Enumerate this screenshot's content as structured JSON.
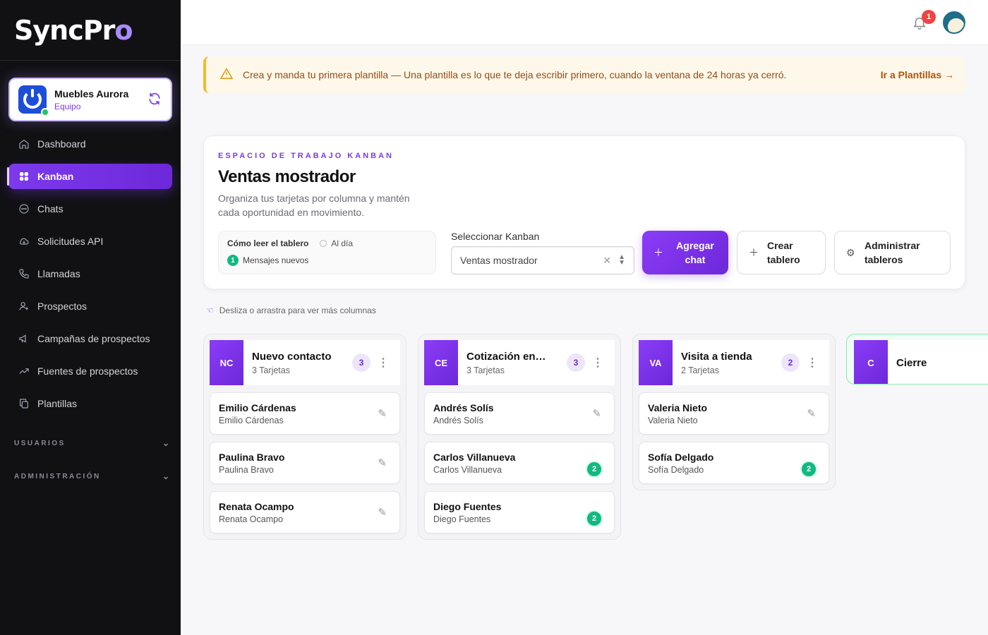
{
  "brand": {
    "name_main": "SyncPr",
    "name_accent": "o"
  },
  "account": {
    "name": "Muebles Aurora",
    "role": "Equipo"
  },
  "nav": [
    {
      "label": "Dashboard",
      "icon": "home-icon"
    },
    {
      "label": "Kanban",
      "icon": "grid-icon",
      "active": true
    },
    {
      "label": "Chats",
      "icon": "chat-icon"
    },
    {
      "label": "Solicitudes API",
      "icon": "cloud-icon"
    },
    {
      "label": "Llamadas",
      "icon": "phone-icon"
    },
    {
      "label": "Prospectos",
      "icon": "user-plus-icon"
    },
    {
      "label": "Campañas de prospectos",
      "icon": "megaphone-icon"
    },
    {
      "label": "Fuentes de prospectos",
      "icon": "trend-icon"
    },
    {
      "label": "Plantillas",
      "icon": "copy-icon"
    }
  ],
  "sections": {
    "users": "USUARIOS",
    "admin": "ADMINISTRACIÓN"
  },
  "topbar": {
    "notifications": "1"
  },
  "banner": {
    "message": "Crea y manda tu primera plantilla — Una plantilla es lo que te deja escribir primero, cuando la ventana de 24 horas ya cerró.",
    "link": "Ir a Plantillas →"
  },
  "workspace": {
    "eyebrow": "ESPACIO DE TRABAJO KANBAN",
    "title": "Ventas mostrador",
    "description": "Organiza tus tarjetas por columna y mantén cada oportunidad en movimiento.",
    "legend": {
      "title": "Cómo leer el tablero",
      "up_to_date": "Al día",
      "new_badge": "1",
      "new_messages": "Mensajes nuevos"
    },
    "select": {
      "label": "Seleccionar Kanban",
      "value": "Ventas mostrador"
    },
    "buttons": {
      "add_chat": "Agregar chat",
      "create_board": "Crear tablero",
      "manage_boards": "Administrar tableros"
    }
  },
  "hint": "Desliza o arrastra para ver más columnas",
  "columns": [
    {
      "abbr": "NC",
      "title": "Nuevo contacto",
      "subtitle": "3 Tarjetas",
      "count": "3",
      "cards": [
        {
          "name": "Emilio Cárdenas",
          "sub": "Emilio Cárdenas",
          "badge": null
        },
        {
          "name": "Paulina Bravo",
          "sub": "Paulina Bravo",
          "badge": null
        },
        {
          "name": "Renata Ocampo",
          "sub": "Renata Ocampo",
          "badge": null
        }
      ]
    },
    {
      "abbr": "CE",
      "title": "Cotización envi...",
      "subtitle": "3 Tarjetas",
      "count": "3",
      "cards": [
        {
          "name": "Andrés Solís",
          "sub": "Andrés Solís",
          "badge": null
        },
        {
          "name": "Carlos Villanueva",
          "sub": "Carlos Villanueva",
          "badge": "2"
        },
        {
          "name": "Diego Fuentes",
          "sub": "Diego Fuentes",
          "badge": "2"
        }
      ]
    },
    {
      "abbr": "VA",
      "title": "Visita a tienda",
      "subtitle": "2 Tarjetas",
      "count": "2",
      "cards": [
        {
          "name": "Valeria Nieto",
          "sub": "Valeria Nieto",
          "badge": null
        },
        {
          "name": "Sofía Delgado",
          "sub": "Sofía Delgado",
          "badge": "2"
        }
      ]
    },
    {
      "abbr": "C",
      "title": "Cierre"
    }
  ],
  "colors": {
    "accent": "#7c3aed",
    "sidebar_bg": "#111114",
    "success": "#10b981",
    "warning_bg": "#fdf8ea"
  }
}
